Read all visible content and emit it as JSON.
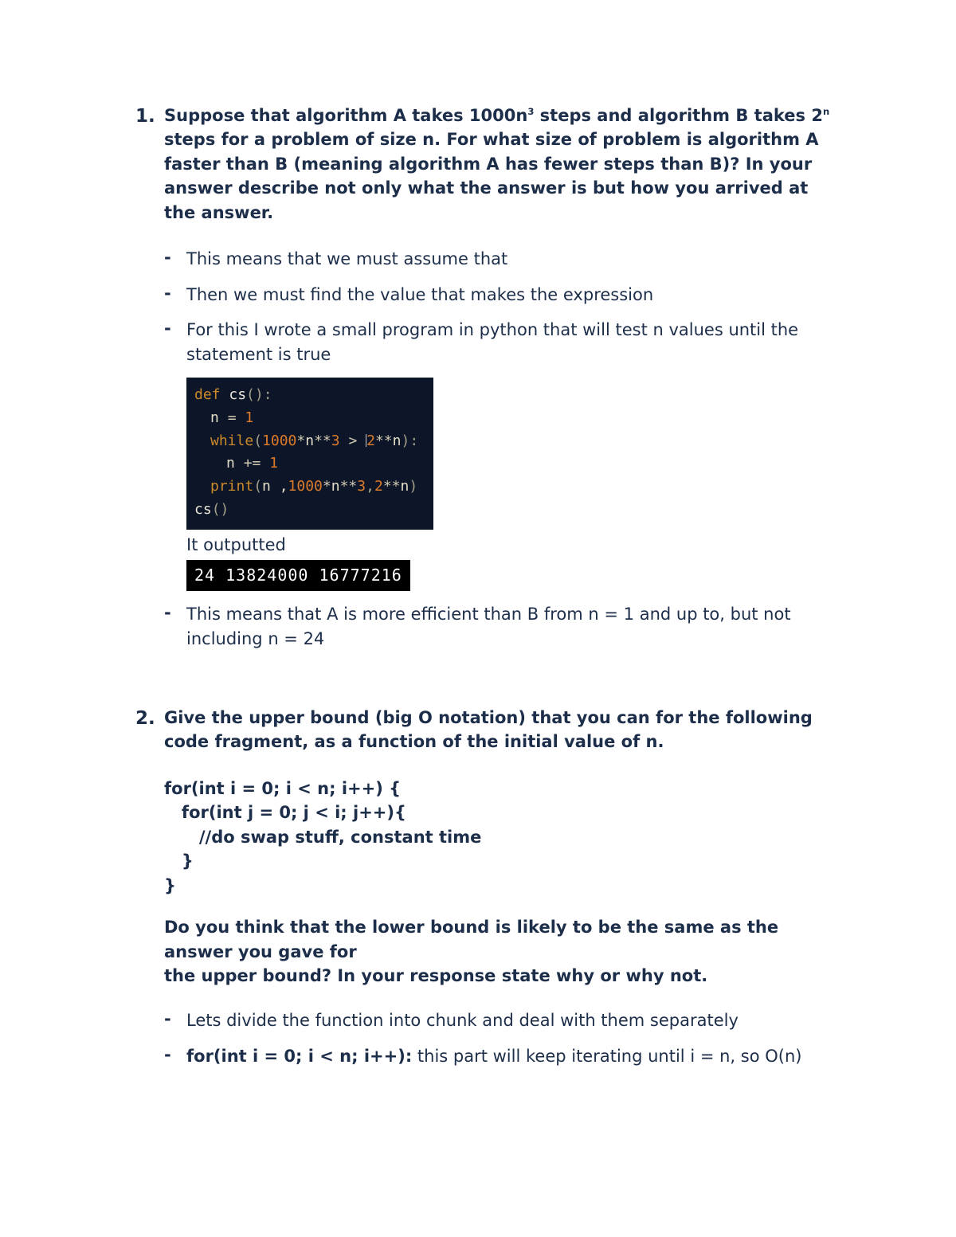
{
  "q1": {
    "number": "1.",
    "prompt_parts": {
      "a": "Suppose that algorithm A takes 1000n",
      "sup_a": "3",
      "b": " steps and algorithm B takes 2",
      "sup_b": "n",
      "c": " steps for a problem of size n. For what size of problem is algorithm A faster than B (meaning algorithm A has fewer steps than B)?  In your answer describe not only what the answer is but how you arrived at the answer."
    },
    "answers": {
      "a1": "This means that we must assume that",
      "a2": "Then we must find the value that makes the expression",
      "a3": "For this I wrote a small program in python that will test n values until the statement is true",
      "code": {
        "l1_def": "def",
        "l1_name": " cs",
        "l1_paren": "():",
        "l2_a": "n ",
        "l2_b": "= ",
        "l2_c": "1",
        "l3_while": "while",
        "l3_open": "(",
        "l3_n1": "1000",
        "l3_star1": "*",
        "l3_nvar1": "n",
        "l3_pow1": "**",
        "l3_p3": "3",
        "l3_gt": " > ",
        "l3_n2": "2",
        "l3_pow2": "**",
        "l3_nvar2": "n",
        "l3_close": "):",
        "l4_a": "n ",
        "l4_b": "+= ",
        "l4_c": "1",
        "l5_print": "print",
        "l5_open": "(",
        "l5_arg1": "n ,",
        "l5_a1000": "1000",
        "l5_star": "*",
        "l5_n": "n",
        "l5_pow": "**",
        "l5_p3": "3",
        "l5_comma": ",",
        "l5_n2": "2",
        "l5_pow2": "**",
        "l5_nvar2": "n",
        "l5_close": ")",
        "l6_call": "cs",
        "l6_paren": "()"
      },
      "caption": "It outputted",
      "output": "24 13824000 16777216",
      "a4": "This means that A is more efficient than B from n = 1 and up to, but not including n = 24"
    }
  },
  "q2": {
    "number": "2.",
    "prompt": "Give the upper bound (big O notation) that you can for the following code fragment, as a function of the initial value of n.",
    "code_lines": "for(int i = 0; i < n; i++) {\n   for(int j = 0; j < i; j++){\n      //do swap stuff, constant time\n   }\n}",
    "prompt2": "Do you think that the lower bound is likely to be the same as the answer you gave for\nthe upper bound? In your response state why or why not.",
    "answers": {
      "a1": "Lets divide the function into chunk and deal with them separately",
      "a2_bold": "for(int i = 0; i < n; i++):",
      "a2_rest": " this part will keep iterating until i = n, so O(n)"
    }
  }
}
